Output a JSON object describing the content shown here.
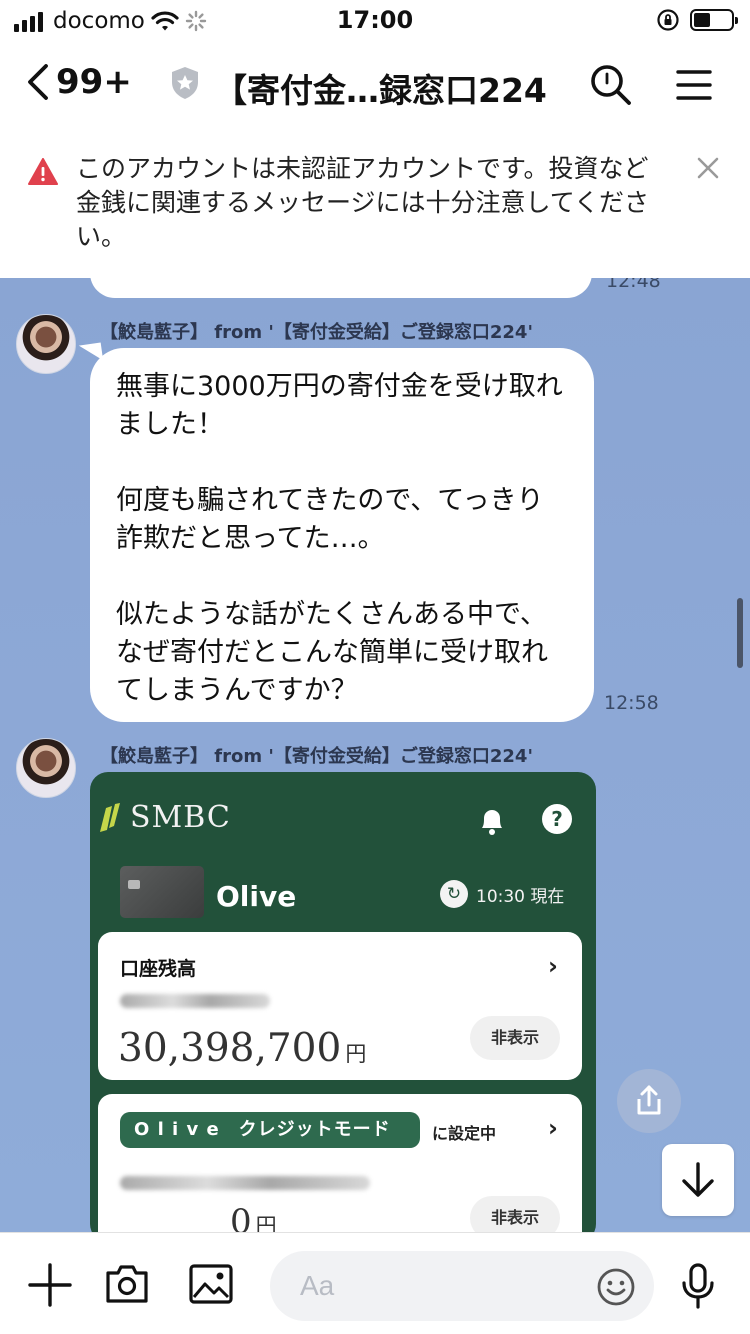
{
  "status_bar": {
    "carrier": "docomo",
    "time": "17:00",
    "battery_level": 0.45
  },
  "header": {
    "back_count": "99+",
    "title": "【寄付金…録窓口224"
  },
  "warning": {
    "text": "このアカウントは未認証アカウントです。投資など金銭に関連するメッセージには十分注意してください。"
  },
  "chat": {
    "prev_time": "12:48",
    "messages": [
      {
        "sender": "【鮫島藍子】 from '【寄付金受給】ご登録窓口224'",
        "paragraphs": [
          "無事に3000万円の寄付金を受け取れました！",
          "何度も騙されてきたので、てっきり詐欺だと思ってた…。",
          "似たような話がたくさんある中で、なぜ寄付だとこんな簡単に受け取れてしまうんですか？"
        ],
        "time": "12:58"
      },
      {
        "sender": "【鮫島藍子】 from '【寄付金受給】ご登録窓口224'",
        "image": {
          "brand": "SMBC",
          "product": "Olive",
          "refresh_time": "10:30 現在",
          "balance_title": "口座残高",
          "balance": "30,398,700",
          "currency": "円",
          "hide_label": "非表示",
          "mode_label": "O l i v e　クレジットモード",
          "mode_suffix": "に設定中",
          "credit_amount": "0",
          "credit_currency": "円",
          "hide_label_2": "非表示"
        }
      }
    ]
  },
  "composer": {
    "placeholder": "Aa"
  },
  "icons": {
    "back": "chevron-left-icon",
    "shield": "shield-star-icon",
    "search": "search-icon",
    "menu": "hamburger-menu-icon",
    "warning": "warning-triangle-icon",
    "close": "close-icon",
    "add": "plus-icon",
    "camera": "camera-icon",
    "image": "image-icon",
    "emoji": "emoji-icon",
    "mic": "microphone-icon",
    "share": "share-icon",
    "scroll_down": "arrow-down-icon"
  },
  "colors": {
    "chat_bg": "#8aa5d3",
    "warning_red": "#e0414d",
    "smbc_green": "#22513a",
    "smbc_pill": "#2e6a4e"
  }
}
